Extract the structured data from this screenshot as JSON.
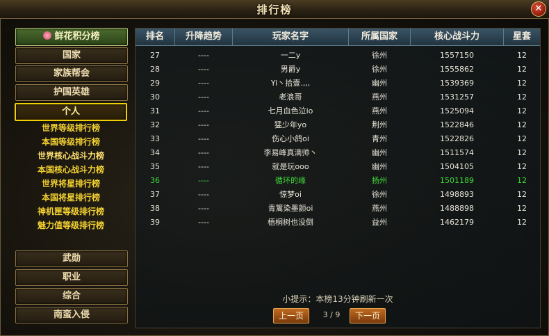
{
  "window": {
    "title": "排行榜"
  },
  "sidebar": {
    "top": "鲜花积分榜",
    "groups": [
      "国家",
      "家族帮会",
      "护国英雄"
    ],
    "selected_group": "个人",
    "subitems": [
      "世界等级排行榜",
      "本国等级排行榜",
      "世界核心战斗力榜",
      "本国核心战斗力榜",
      "世界将星排行榜",
      "本国将星排行榜",
      "神机匣等级排行榜",
      "魅力值等级排行榜"
    ],
    "bottom": [
      "武勋",
      "职业",
      "综合",
      "南蛮入侵"
    ]
  },
  "table": {
    "headers": [
      "排名",
      "升降趋势",
      "玩家名字",
      "所属国家",
      "核心战斗力",
      "星套"
    ],
    "rows": [
      [
        "27",
        "----",
        "一二y",
        "徐州",
        "1557150",
        "12"
      ],
      [
        "28",
        "----",
        "男爵y",
        "徐州",
        "1555862",
        "12"
      ],
      [
        "29",
        "----",
        "Yi丶拾壹.,,,",
        "幽州",
        "1539369",
        "12"
      ],
      [
        "30",
        "----",
        "老浪哥",
        "燕州",
        "1531257",
        "12"
      ],
      [
        "31",
        "----",
        "七月血色泣io",
        "燕州",
        "1525094",
        "12"
      ],
      [
        "32",
        "----",
        "猛少年yo",
        "荆州",
        "1522846",
        "12"
      ],
      [
        "33",
        "----",
        "伤心小鸽oi",
        "青州",
        "1522826",
        "12"
      ],
      [
        "34",
        "----",
        "李易峰真滴帅丶",
        "幽州",
        "1511574",
        "12"
      ],
      [
        "35",
        "----",
        "就是玩ooo",
        "幽州",
        "1504105",
        "12"
      ],
      [
        "36",
        "----",
        "循环的缘",
        "扬州",
        "1501189",
        "12"
      ],
      [
        "37",
        "----",
        "惊梦oi",
        "徐州",
        "1498893",
        "12"
      ],
      [
        "38",
        "----",
        "青篱染墨颜oi",
        "燕州",
        "1488898",
        "12"
      ],
      [
        "39",
        "----",
        "梧桐树也没倒",
        "益州",
        "1462179",
        "12"
      ]
    ],
    "highlight_rank": "36"
  },
  "footer": {
    "hint": "小提示：本榜13分钟刷新一次",
    "prev": "上一页",
    "next": "下一页",
    "page": "3 / 9"
  },
  "colors": {
    "highlight": "#3fdc3a",
    "selected_border": "#f0d000"
  }
}
